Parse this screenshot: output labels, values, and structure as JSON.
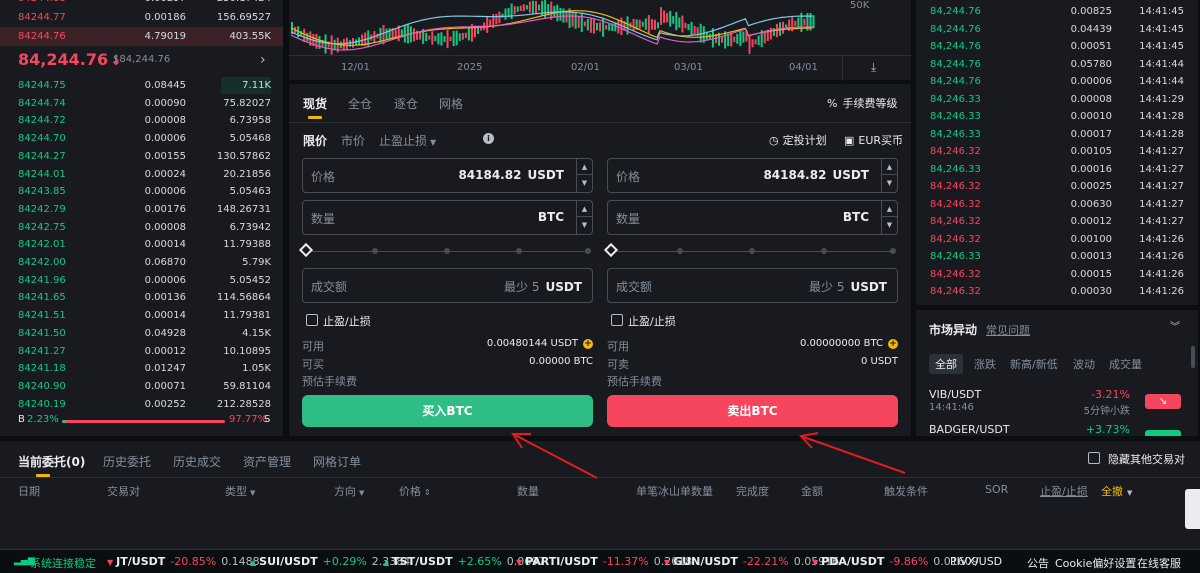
{
  "orderbook": {
    "top_asks": [
      {
        "price": "84244.77",
        "qty": "0.00186",
        "total": "156.69527"
      },
      {
        "price": "84244.76",
        "qty": "4.79019",
        "total": "403.55K"
      }
    ],
    "last_price": "84,244.76",
    "last_arrow": "↓",
    "last_usd": "$84,244.76",
    "expand_icon": "chevron-right",
    "bids": [
      {
        "price": "84244.75",
        "qty": "0.08445",
        "total": "7.11K"
      },
      {
        "price": "84244.74",
        "qty": "0.00090",
        "total": "75.82027"
      },
      {
        "price": "84244.72",
        "qty": "0.00008",
        "total": "6.73958"
      },
      {
        "price": "84244.70",
        "qty": "0.00006",
        "total": "5.05468"
      },
      {
        "price": "84244.27",
        "qty": "0.00155",
        "total": "130.57862"
      },
      {
        "price": "84244.01",
        "qty": "0.00024",
        "total": "20.21856"
      },
      {
        "price": "84243.85",
        "qty": "0.00006",
        "total": "5.05463"
      },
      {
        "price": "84242.79",
        "qty": "0.00176",
        "total": "148.26731"
      },
      {
        "price": "84242.75",
        "qty": "0.00008",
        "total": "6.73942"
      },
      {
        "price": "84242.01",
        "qty": "0.00014",
        "total": "11.79388"
      },
      {
        "price": "84242.00",
        "qty": "0.06870",
        "total": "5.79K"
      },
      {
        "price": "84241.96",
        "qty": "0.00006",
        "total": "5.05452"
      },
      {
        "price": "84241.65",
        "qty": "0.00136",
        "total": "114.56864"
      },
      {
        "price": "84241.51",
        "qty": "0.00014",
        "total": "11.79381"
      },
      {
        "price": "84241.50",
        "qty": "0.04928",
        "total": "4.15K"
      },
      {
        "price": "84241.27",
        "qty": "0.00012",
        "total": "10.10895"
      },
      {
        "price": "84241.18",
        "qty": "0.01247",
        "total": "1.05K"
      },
      {
        "price": "84240.90",
        "qty": "0.00071",
        "total": "59.81104"
      },
      {
        "price": "84240.19",
        "qty": "0.00252",
        "total": "212.28528"
      }
    ],
    "ratio": {
      "b_label": "B",
      "b_pct": "2.23%",
      "b_fraction": 0.0223,
      "s_pct": "97.77%",
      "s_label": "S"
    }
  },
  "chart": {
    "y_label": "50K",
    "x_labels": [
      "12/01",
      "2025",
      "02/01",
      "03/01",
      "04/01"
    ],
    "colors": {
      "up": "#0ecb81",
      "down": "#f6465d",
      "ma1": "#f0b90b",
      "ma2": "#e05dc0",
      "ma3": "#7ec8e3"
    }
  },
  "form": {
    "tabs": [
      "现货",
      "全仓",
      "逐仓",
      "网格"
    ],
    "fee_level": "手续费等级",
    "order_types": [
      "限价",
      "市价",
      "止盈止损"
    ],
    "dca_plan": "定投计划",
    "eur_buy": "EUR买币",
    "buy": {
      "price_label": "价格",
      "price_value": "84184.82",
      "price_unit": "USDT",
      "qty_label": "数量",
      "qty_unit": "BTC",
      "total_label": "成交额",
      "total_min": "最少 5",
      "total_unit": "USDT",
      "tpsl": "止盈/止损",
      "avail_label": "可用",
      "avail_value": "0.00480144 USDT",
      "can_label": "可买",
      "can_value": "0.00000 BTC",
      "fee_label": "预估手续费",
      "button": "买入BTC"
    },
    "sell": {
      "price_label": "价格",
      "price_value": "84184.82",
      "price_unit": "USDT",
      "qty_label": "数量",
      "qty_unit": "BTC",
      "total_label": "成交额",
      "total_min": "最少 5",
      "total_unit": "USDT",
      "tpsl": "止盈/止损",
      "avail_label": "可用",
      "avail_value": "0.00000000 BTC",
      "can_label": "可卖",
      "can_value": "0 USDT",
      "fee_label": "预估手续费",
      "button": "卖出BTC"
    }
  },
  "trades": [
    {
      "price": "84,244.76",
      "qty": "0.00825",
      "time": "14:41:45",
      "side": "buy"
    },
    {
      "price": "84,244.76",
      "qty": "0.04439",
      "time": "14:41:45",
      "side": "buy"
    },
    {
      "price": "84,244.76",
      "qty": "0.00051",
      "time": "14:41:45",
      "side": "buy"
    },
    {
      "price": "84,244.76",
      "qty": "0.05780",
      "time": "14:41:44",
      "side": "buy"
    },
    {
      "price": "84,244.76",
      "qty": "0.00006",
      "time": "14:41:44",
      "side": "buy"
    },
    {
      "price": "84,246.33",
      "qty": "0.00008",
      "time": "14:41:29",
      "side": "buy"
    },
    {
      "price": "84,246.33",
      "qty": "0.00010",
      "time": "14:41:28",
      "side": "buy"
    },
    {
      "price": "84,246.33",
      "qty": "0.00017",
      "time": "14:41:28",
      "side": "buy"
    },
    {
      "price": "84,246.32",
      "qty": "0.00105",
      "time": "14:41:27",
      "side": "sell"
    },
    {
      "price": "84,246.33",
      "qty": "0.00016",
      "time": "14:41:27",
      "side": "buy"
    },
    {
      "price": "84,246.32",
      "qty": "0.00025",
      "time": "14:41:27",
      "side": "sell"
    },
    {
      "price": "84,246.32",
      "qty": "0.00630",
      "time": "14:41:27",
      "side": "sell"
    },
    {
      "price": "84,246.32",
      "qty": "0.00012",
      "time": "14:41:27",
      "side": "sell"
    },
    {
      "price": "84,246.32",
      "qty": "0.00100",
      "time": "14:41:26",
      "side": "sell"
    },
    {
      "price": "84,246.33",
      "qty": "0.00013",
      "time": "14:41:26",
      "side": "buy"
    },
    {
      "price": "84,246.32",
      "qty": "0.00015",
      "time": "14:41:26",
      "side": "sell"
    }
  ],
  "movers": {
    "title": "市场异动",
    "faq": "常见问题",
    "tabs": [
      "全部",
      "涨跌",
      "新高/新低",
      "波动",
      "成交量"
    ],
    "items": [
      {
        "pair": "VIB/USDT",
        "time": "14:41:46",
        "change": "-3.21%",
        "desc": "5分钟小跌",
        "dir": "down"
      },
      {
        "pair": "BADGER/USDT",
        "time": "",
        "change": "+3.73%",
        "desc": "",
        "dir": "up"
      }
    ]
  },
  "orders": {
    "tabs": [
      "当前委托(0)",
      "历史委托",
      "历史成交",
      "资产管理",
      "网格订单"
    ],
    "hide_others": "隐藏其他交易对",
    "columns": [
      "日期",
      "交易对",
      "类型",
      "方向",
      "价格",
      "数量",
      "单笔冰山单数量",
      "完成度",
      "金额",
      "触发条件",
      "SOR",
      "止盈/止损",
      "全撤"
    ]
  },
  "ticker": {
    "status": "系统连接稳定",
    "items": [
      {
        "pair": "JT/USDT",
        "change": "-20.85%",
        "price": "0.1488",
        "dir": "down"
      },
      {
        "pair": "SUI/USDT",
        "change": "+0.29%",
        "price": "2.3384",
        "dir": "up"
      },
      {
        "pair": "TST/USDT",
        "change": "+2.65%",
        "price": "0.0697",
        "dir": "up"
      },
      {
        "pair": "PARTI/USDT",
        "change": "-11.37%",
        "price": "0.2018",
        "dir": "down"
      },
      {
        "pair": "GUN/USDT",
        "change": "-22.21%",
        "price": "0.05916",
        "dir": "down"
      },
      {
        "pair": "PDA/USDT",
        "change": "-9.86%",
        "price": "0.01609",
        "dir": "down"
      }
    ],
    "last_pair": "PIVX/USD",
    "announcement": "公告",
    "cookie": "Cookie偏好设置",
    "support": "在线客服"
  }
}
